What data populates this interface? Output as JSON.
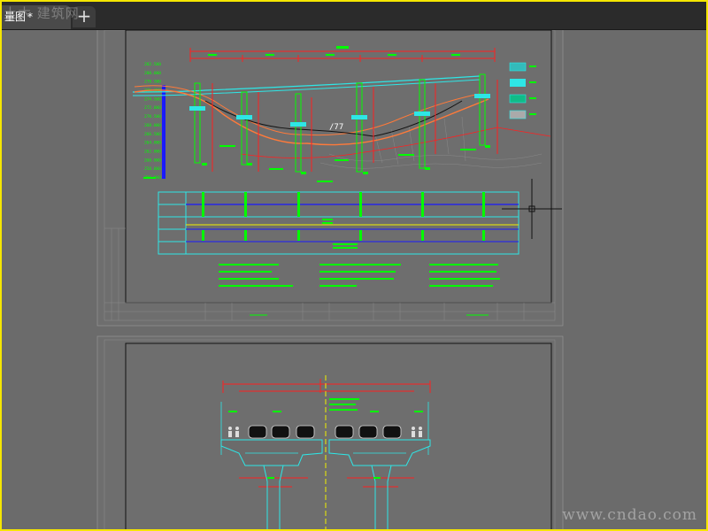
{
  "app": {
    "tabs": [
      {
        "label": "量图",
        "close_glyph": "*"
      }
    ],
    "new_tab_glyph": "+"
  },
  "watermarks": {
    "header_logo": "土木 建筑网",
    "footer": "www.cndao.com"
  },
  "drawing": {
    "elevation_labels": [
      "282.500",
      "280.000",
      "278.500",
      "276.000",
      "274.500",
      "272.000",
      "270.500",
      "268.000",
      "266.500",
      "264.000",
      "262.000",
      "260.000",
      "258.000",
      "256.000"
    ],
    "water_symbol": "/77",
    "table_rows": 6
  },
  "colors": {
    "accent_border": "#f5e600",
    "tab_bar": "#2b2b2b",
    "canvas": "#6b6b6b",
    "cad_green": "#00ff00",
    "cad_red": "#ff2020",
    "cad_cyan": "#2ee6e6",
    "cad_yellow": "#f0f000",
    "cad_blue": "#1a1aff",
    "cad_orange": "#ff7a3a"
  }
}
